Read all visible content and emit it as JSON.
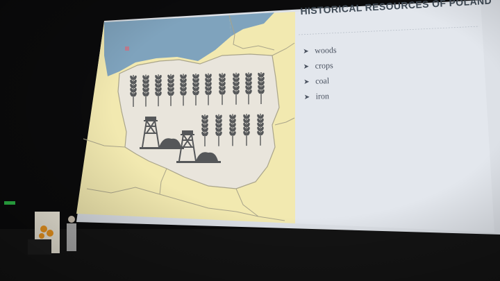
{
  "slide": {
    "title": "HISTORICAL RESOURCES OF POLAND",
    "bullets": [
      {
        "label": "woods",
        "icon": "arrow-bullet-icon"
      },
      {
        "label": "crops",
        "icon": "arrow-bullet-icon"
      },
      {
        "label": "coal",
        "icon": "arrow-bullet-icon"
      },
      {
        "label": "iron",
        "icon": "arrow-bullet-icon"
      }
    ],
    "arrow_glyph": "➤"
  },
  "map": {
    "icons": [
      "wheat-icon",
      "mine-shaft-icon",
      "coal-pile-icon"
    ],
    "colors": {
      "land": "#f2e9b0",
      "poland": "#e9e5dc",
      "sea": "#7fa3bd",
      "border": "#a9a48a",
      "icons": "#555759"
    }
  },
  "colors": {
    "screen_bg": "#e4e8ee",
    "title": "#3f4a55",
    "room": "#0b0b0c"
  }
}
